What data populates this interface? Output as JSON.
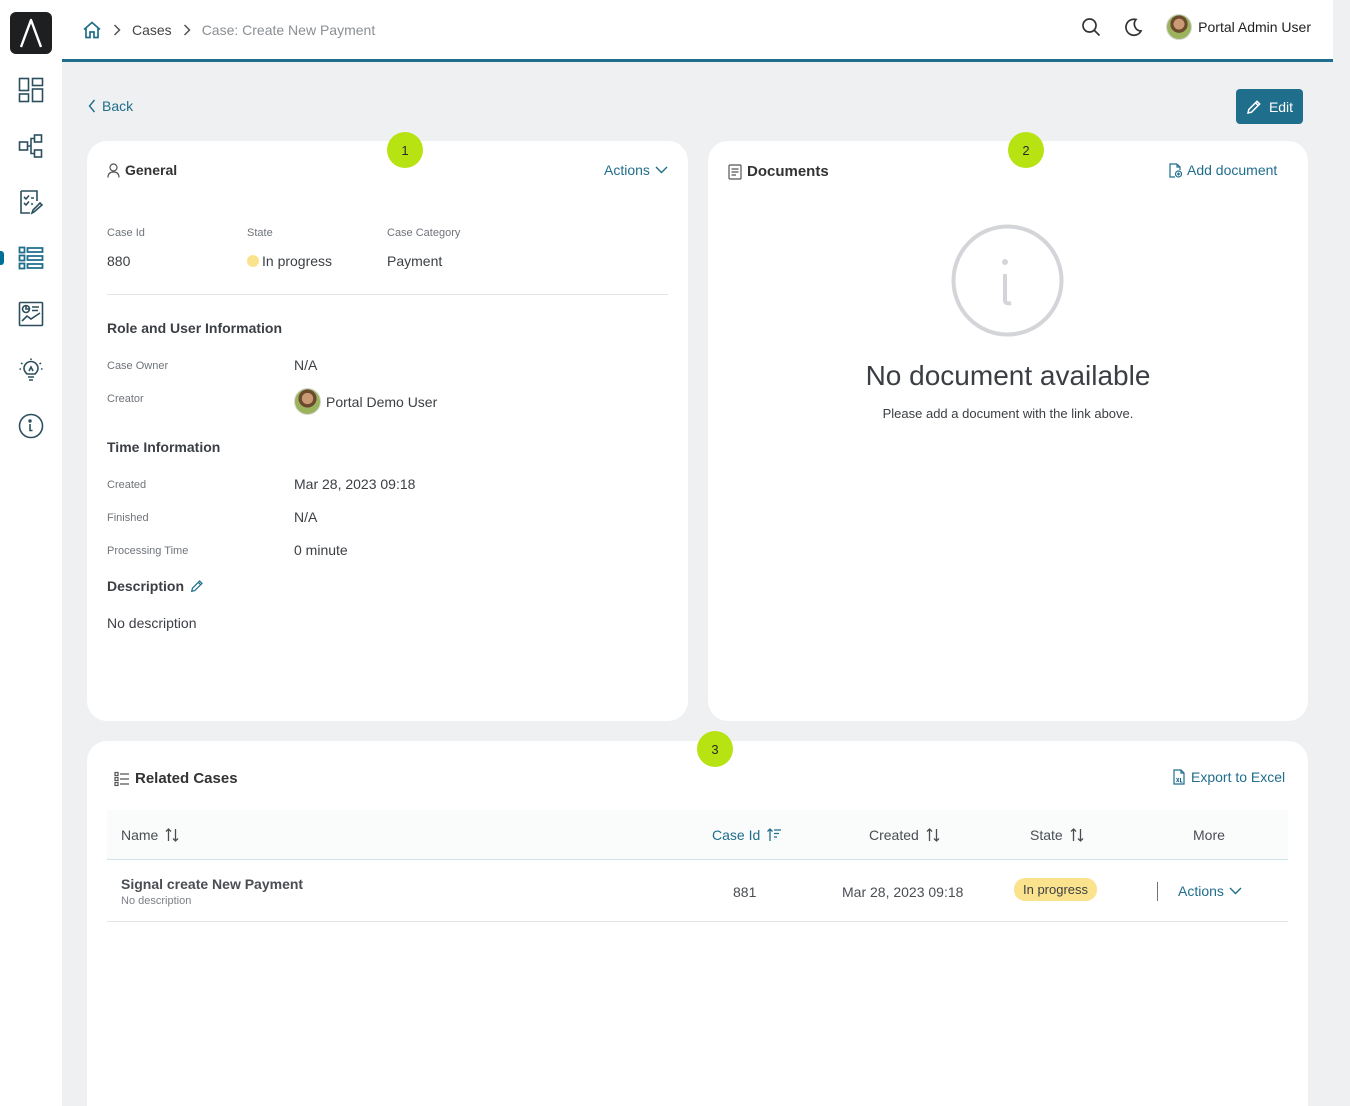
{
  "topbar": {
    "breadcrumb": {
      "cases": "Cases",
      "current": "Case: Create New Payment"
    },
    "user_name": "Portal Admin User"
  },
  "actions": {
    "back": "Back",
    "edit": "Edit"
  },
  "general": {
    "badge": "1",
    "title": "General",
    "actions_label": "Actions",
    "case_id_label": "Case Id",
    "case_id": "880",
    "state_label": "State",
    "state": "In progress",
    "category_label": "Case Category",
    "category": "Payment",
    "role_section": "Role and User Information",
    "owner_label": "Case Owner",
    "owner": "N/A",
    "creator_label": "Creator",
    "creator": "Portal Demo User",
    "time_section": "Time Information",
    "created_label": "Created",
    "created": "Mar 28, 2023 09:18",
    "finished_label": "Finished",
    "finished": "N/A",
    "processing_label": "Processing Time",
    "processing": "0 minute",
    "description_section": "Description",
    "description": "No description"
  },
  "documents": {
    "badge": "2",
    "title": "Documents",
    "add_label": "Add document",
    "empty_title": "No document available",
    "empty_hint": "Please add a document with the link above."
  },
  "related": {
    "badge": "3",
    "title": "Related Cases",
    "export_label": "Export to Excel",
    "columns": {
      "name": "Name",
      "case_id": "Case Id",
      "created": "Created",
      "state": "State",
      "more": "More"
    },
    "rows": [
      {
        "name": "Signal create New Payment",
        "description": "No description",
        "case_id": "881",
        "created": "Mar 28, 2023 09:18",
        "state": "In progress",
        "actions": "Actions"
      }
    ]
  },
  "colors": {
    "accent": "#1f6e8c",
    "badge": "#b7e313",
    "in_progress": "#fbe38e"
  }
}
